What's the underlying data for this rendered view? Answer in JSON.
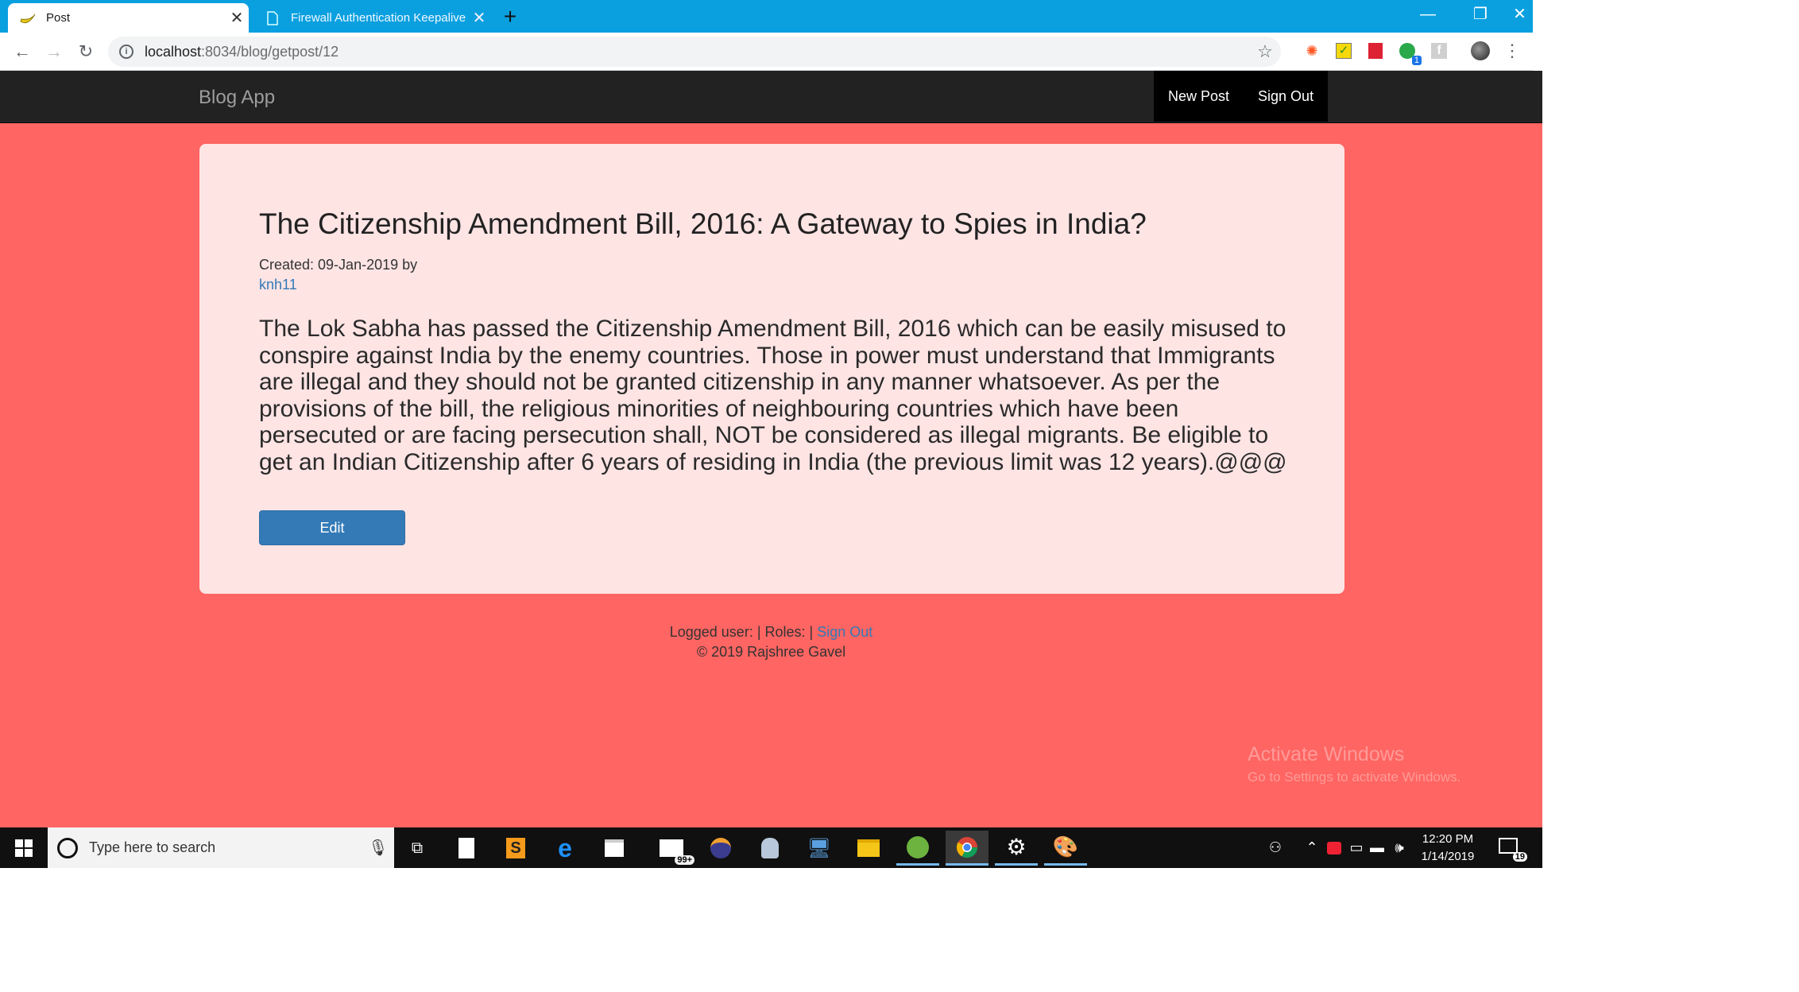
{
  "browser": {
    "tabs": [
      {
        "title": "Post",
        "icon": "banana-icon",
        "active": true
      },
      {
        "title": "Firewall Authentication Keepalive",
        "icon": "page-icon",
        "active": false
      }
    ],
    "url_host": "localhost",
    "url_rest": ":8034/blog/getpost/12",
    "extensions": [
      "puzzle-orange-icon",
      "notes-yellow-icon",
      "red-square-icon",
      "green-badge-icon",
      "facebook-icon",
      "avatar-icon",
      "menu-dots-icon"
    ],
    "extension_badge": "1"
  },
  "navbar": {
    "brand": "Blog App",
    "links": [
      "New Post",
      "Sign Out"
    ]
  },
  "post": {
    "title": "The Citizenship Amendment Bill, 2016: A Gateway to Spies in India?",
    "created": "Created: 09-Jan-2019 by",
    "author": "knh11",
    "body": "The Lok Sabha has passed the Citizenship Amendment Bill, 2016 which can be easily misused to conspire against India by the enemy countries. Those in power must understand that Immigrants are illegal and they should not be granted citizenship in any manner whatsoever. As per the provisions of the bill, the religious minorities of neighbouring countries which have been persecuted or are facing persecution shall, NOT be considered as illegal migrants. Be eligible to get an Indian Citizenship after 6 years of residing in India (the previous limit was 12 years).@@@",
    "edit_label": "Edit"
  },
  "footer": {
    "logged_text": "Logged user: | Roles: | ",
    "sign_out": "Sign Out",
    "copyright": "© 2019 Rajshree Gavel"
  },
  "watermark": {
    "title": "Activate Windows",
    "subtitle": "Go to Settings to activate Windows."
  },
  "taskbar": {
    "search_placeholder": "Type here to search",
    "mail_badge": "99+",
    "time": "12:20 PM",
    "date": "1/14/2019",
    "notification_count": "19"
  },
  "colors": {
    "page_background": "#ff6562",
    "card_background": "#ffe4e4",
    "navbar": "#222222",
    "primary_button": "#337ab7",
    "tabstrip": "#0aa0e0"
  }
}
